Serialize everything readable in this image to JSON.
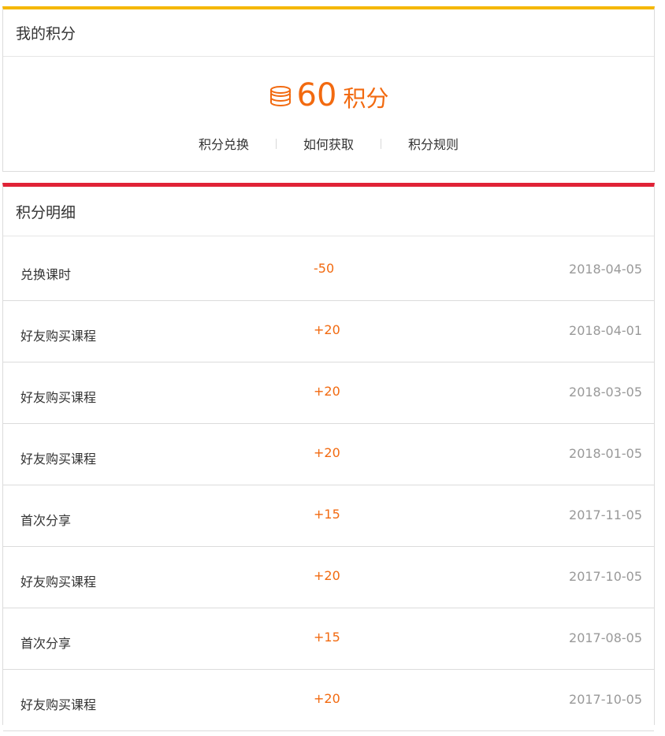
{
  "points_section": {
    "title": "我的积分",
    "points": "60",
    "unit": "积分",
    "icon": "coin-stack-icon",
    "links": [
      "积分兑换",
      "如何获取",
      "积分规则"
    ]
  },
  "detail_section": {
    "title": "积分明细",
    "rows": [
      {
        "name": "兑换课时",
        "amount": "-50",
        "date": "2018-04-05"
      },
      {
        "name": "好友购买课程",
        "amount": "+20",
        "date": "2018-04-01"
      },
      {
        "name": "好友购买课程",
        "amount": "+20",
        "date": "2018-03-05"
      },
      {
        "name": "好友购买课程",
        "amount": "+20",
        "date": "2018-01-05"
      },
      {
        "name": "首次分享",
        "amount": "+15",
        "date": "2017-11-05"
      },
      {
        "name": "好友购买课程",
        "amount": "+20",
        "date": "2017-10-05"
      },
      {
        "name": "首次分享",
        "amount": "+15",
        "date": "2017-08-05"
      },
      {
        "name": "好友购买课程",
        "amount": "+20",
        "date": "2017-10-05"
      }
    ]
  },
  "colors": {
    "accent_orange": "#f26a10",
    "top_bar_yellow": "#f5b700",
    "detail_bar_red": "#e02236",
    "date_gray": "#999999"
  }
}
